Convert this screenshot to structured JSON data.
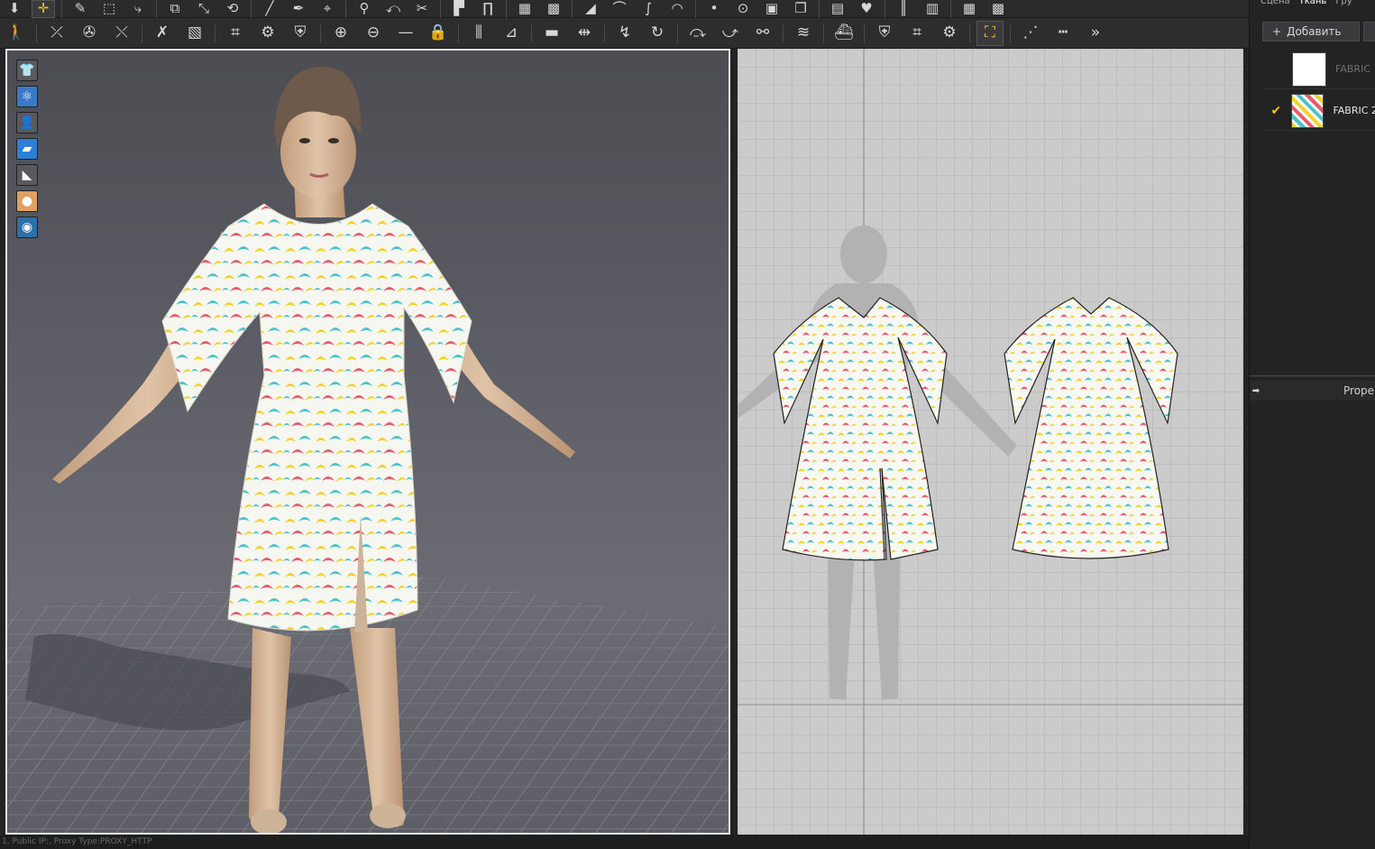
{
  "toolbar_top": {
    "icons": [
      "down-arrow-icon",
      "move-icon",
      "edit-pattern-icon",
      "transform-icon",
      "edit-curve-icon",
      "sew-icon",
      "seam-icon",
      "fold-icon",
      "line-icon",
      "brush-icon",
      "pin-icon",
      "tack-icon",
      "segment-icon",
      "trim-icon",
      "shirt-icon",
      "pants-icon",
      "grid-icon",
      "mesh-icon",
      "fill-triangle-icon",
      "bezier-icon",
      "curve-icon",
      "arc-icon",
      "point-icon",
      "curve-point-icon",
      "block-icon",
      "copy-icon",
      "paste-icon",
      "heart-icon",
      "columns-icon",
      "bars-icon",
      "grid-3d-icon",
      "mesh-3d-icon"
    ]
  },
  "toolbar_second": {
    "icons": [
      "avatar-icon",
      "select-pin-icon",
      "pin-tool-icon",
      "pull-icon",
      "cut-icon",
      "fold-book-icon",
      "select-mesh-icon",
      "fitting-icon",
      "shirt-detail-icon",
      "button-icon",
      "buttonhole-icon",
      "line-tool-icon",
      "lock-icon",
      "zipper-icon",
      "sleeve-icon",
      "measure-icon",
      "arrange-icon",
      "segment-sew-icon",
      "free-sew-icon",
      "seam-2d-icon",
      "sew-2d-icon",
      "edit-sew-icon",
      "topstitch-icon",
      "iron-icon",
      "shirt-2d-icon",
      "select-mesh-2d-icon",
      "fitting-2d-icon",
      "check-2d-icon",
      "dotted-line-icon",
      "dash-icon",
      "more-icon"
    ]
  },
  "viewport_tools": [
    "garment-display-icon",
    "physics-icon",
    "avatar-display-icon",
    "fabric-display-icon",
    "render-icon",
    "skin-icon",
    "environment-icon"
  ],
  "right_panel": {
    "tabs": [
      "Сцена",
      "Ткань",
      "Гру"
    ],
    "add_label": "Добавить",
    "fabrics": [
      {
        "name": "FABRIC",
        "color": "#6f6f6f",
        "checked": false,
        "thumb": "white"
      },
      {
        "name": "FABRIC 2",
        "color": "#e6e6e6",
        "checked": true,
        "thumb": "pattern"
      }
    ],
    "property_label": "Proper"
  },
  "status": "1, Public IP:, Proxy Type:PROXY_HTTP",
  "colors": {
    "accent": "#f2c12e",
    "viewport_border": "#e8e8e8"
  }
}
